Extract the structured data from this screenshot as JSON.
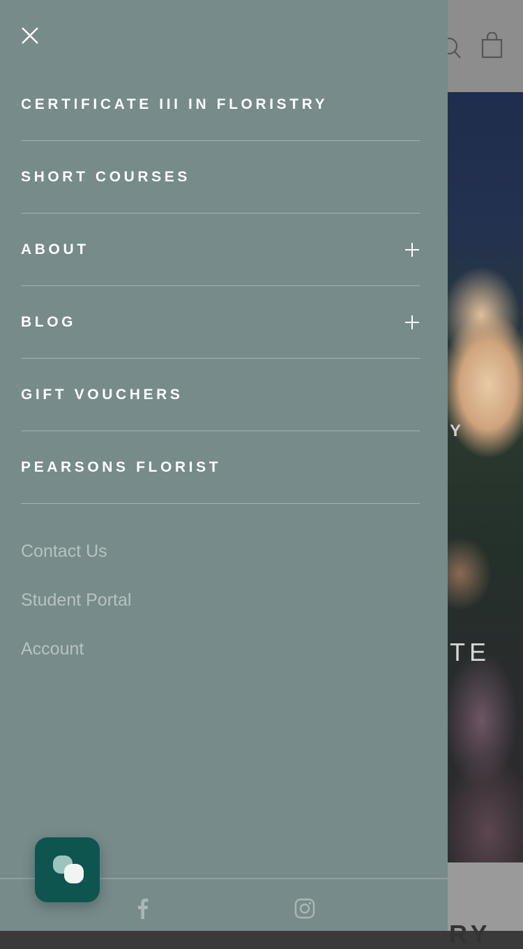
{
  "drawer": {
    "menu_items": [
      {
        "label": "CERTIFICATE III IN FLORISTRY",
        "expandable": false
      },
      {
        "label": "SHORT COURSES",
        "expandable": false
      },
      {
        "label": "ABOUT",
        "expandable": true
      },
      {
        "label": "BLOG",
        "expandable": true
      },
      {
        "label": "GIFT VOUCHERS",
        "expandable": false
      },
      {
        "label": "PEARSONS FLORIST",
        "expandable": false
      }
    ],
    "secondary_links": [
      "Contact Us",
      "Student Portal",
      "Account"
    ],
    "social": [
      "facebook-icon",
      "instagram-icon"
    ]
  },
  "background": {
    "hero_letters": [
      "Y",
      "TE",
      "RY"
    ],
    "header_icons": [
      "search-icon",
      "shopping-bag-icon"
    ]
  },
  "icons": {
    "close": "close-icon",
    "expand": "plus-icon",
    "chat": "chat-icon"
  },
  "colors": {
    "drawer_bg": "#768b8a",
    "divider": "#a4b3b2",
    "secondary_text": "#b6c3c2",
    "chat_button": "#0e5550"
  }
}
